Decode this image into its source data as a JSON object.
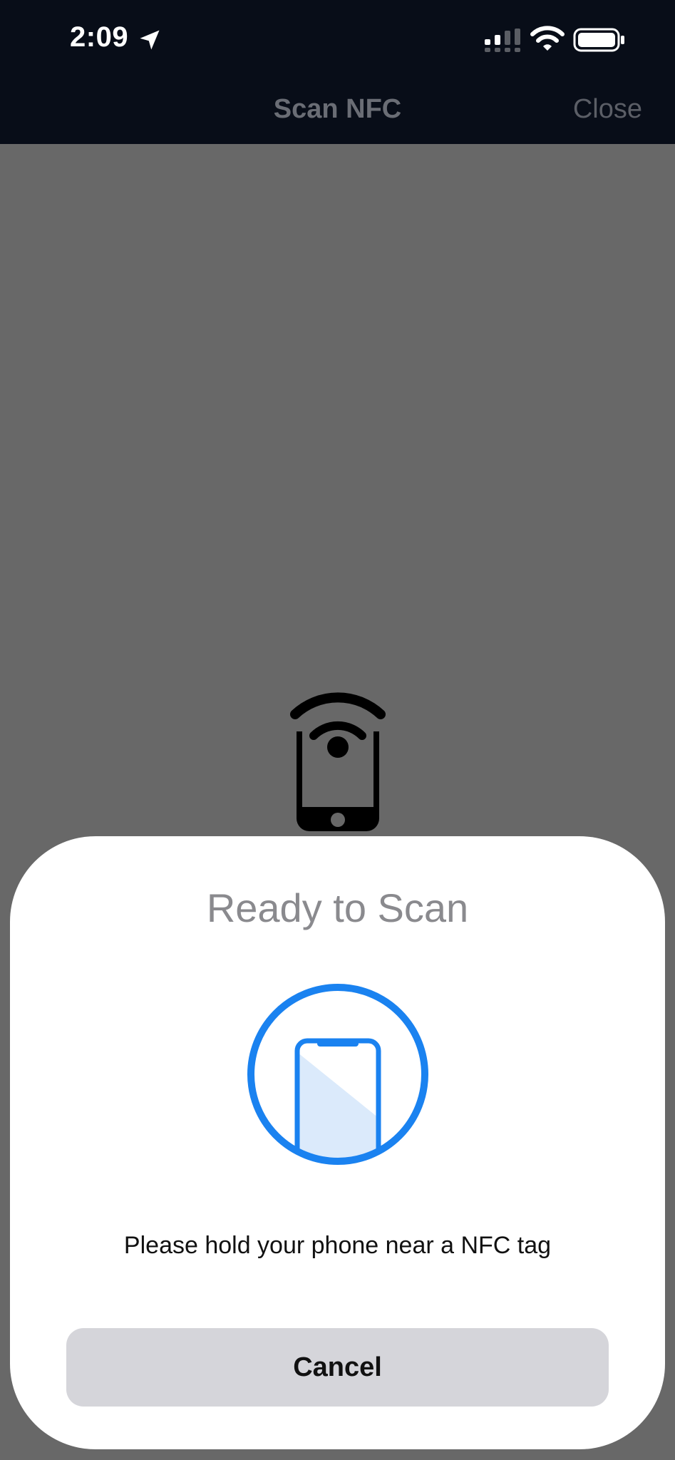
{
  "status_bar": {
    "time": "2:09",
    "icons": [
      "location-arrow-icon",
      "cellular-signal-icon",
      "wifi-icon",
      "battery-icon"
    ]
  },
  "nav": {
    "title": "Scan NFC",
    "close_label": "Close"
  },
  "background": {
    "icon": "nfc-phone-icon"
  },
  "scan_sheet": {
    "title": "Ready to Scan",
    "illustration_icon": "phone-scan-icon",
    "message": "Please hold your phone near a NFC tag",
    "cancel_label": "Cancel"
  },
  "colors": {
    "accent": "#1a82f0",
    "dim_overlay": "#686868",
    "header_bg": "#080d18",
    "button_bg": "#d5d5da"
  }
}
